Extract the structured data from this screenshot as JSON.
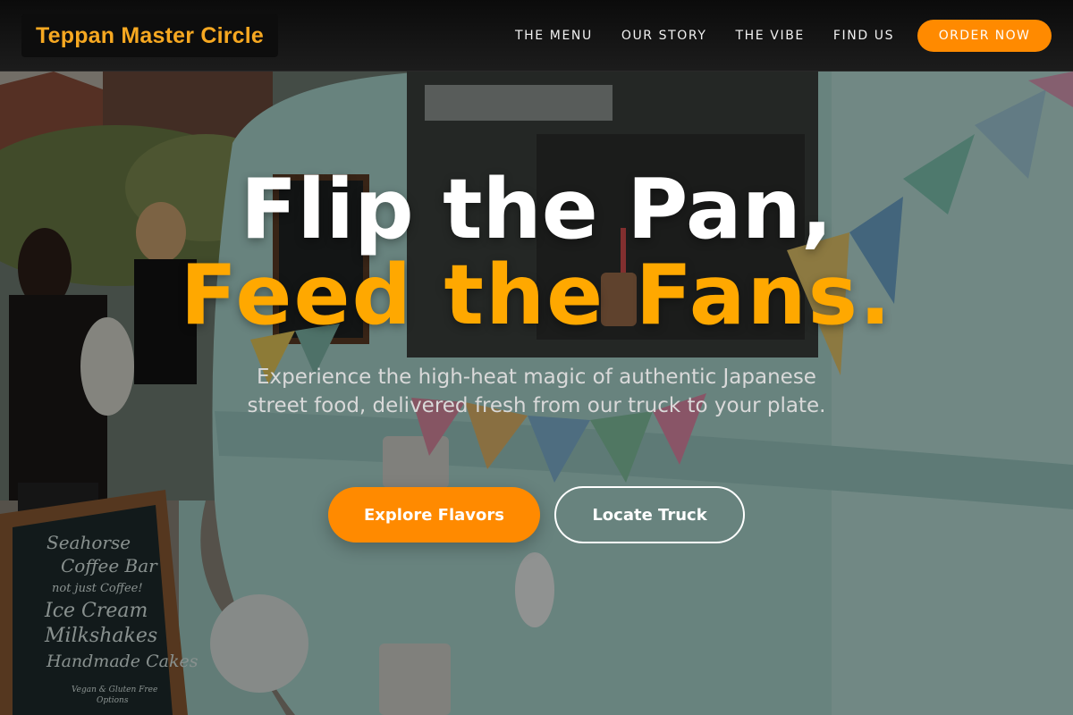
{
  "header": {
    "logo_text": "Teppan Master Circle",
    "nav": [
      {
        "label": "THE MENU"
      },
      {
        "label": "OUR STORY"
      },
      {
        "label": "THE VIBE"
      },
      {
        "label": "FIND US"
      }
    ],
    "order_button": "ORDER NOW"
  },
  "hero": {
    "headline_line1": "Flip the Pan,",
    "headline_line2": "Feed the Fans.",
    "subtitle": "Experience the high-heat magic of authentic Japanese street food, delivered fresh from our truck to your plate.",
    "primary_cta": "Explore Flavors",
    "secondary_cta": "Locate Truck"
  },
  "background_sign": {
    "lines": [
      "Seahorse",
      "Coffee Bar",
      "not just Coffee!",
      "Ice Cream",
      "Milkshakes",
      "Handmade Cakes",
      "Vegan & Gluten Free",
      "Options"
    ]
  },
  "colors": {
    "accent": "#ff8a00",
    "headline_accent": "#ffa800",
    "logo": "#f6a821",
    "header_bg": "#111111"
  }
}
